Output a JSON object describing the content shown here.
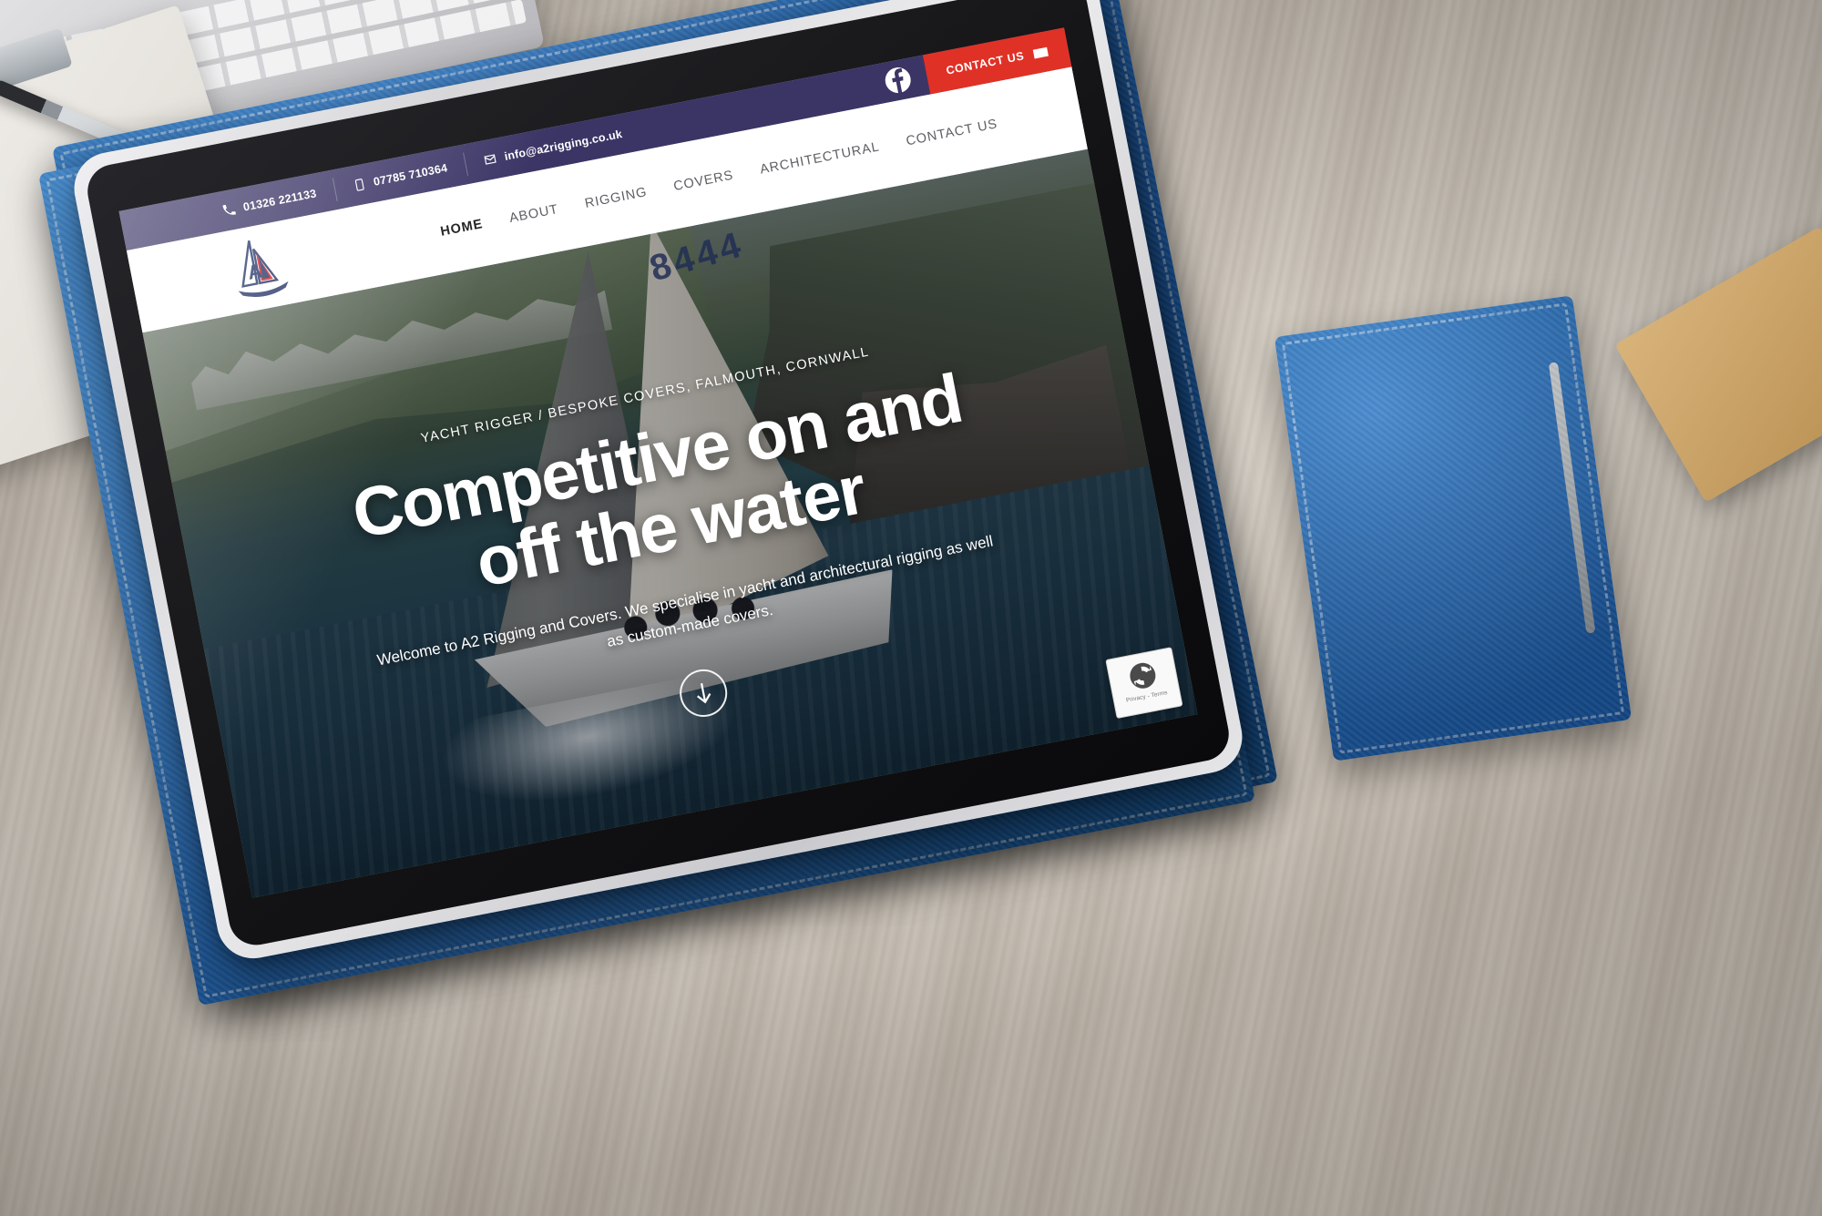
{
  "topbar": {
    "background_color": "#3b3566",
    "contacts": [
      {
        "icon": "phone-icon",
        "text": "01326 221133"
      },
      {
        "icon": "mobile-icon",
        "text": "07785 710364"
      },
      {
        "icon": "envelope-icon",
        "text": "info@a2rigging.co.uk"
      }
    ],
    "facebook_icon": "facebook-icon",
    "contact_button": {
      "label": "CONTACT US",
      "icon": "mail-send-icon",
      "color": "#e03127"
    }
  },
  "navbar": {
    "logo_alt": "A2 Rigging and Covers logo",
    "links": [
      {
        "label": "HOME",
        "active": true
      },
      {
        "label": "ABOUT",
        "active": false
      },
      {
        "label": "RIGGING",
        "active": false
      },
      {
        "label": "COVERS",
        "active": false
      },
      {
        "label": "ARCHITECTURAL",
        "active": false
      },
      {
        "label": "CONTACT US",
        "active": false
      }
    ]
  },
  "hero": {
    "eyebrow": "YACHT RIGGER / BESPOKE COVERS, FALMOUTH, CORNWALL",
    "title_line1": "Competitive on and",
    "title_line2": "off the water",
    "subtitle": "Welcome to A2 Rigging and Covers. We specialise in yacht and architectural rigging as well as custom-made covers.",
    "scroll_icon": "arrow-down-icon",
    "sail_number": "8444"
  },
  "recaptcha": {
    "icon": "recaptcha-icon",
    "text": "Privacy - Terms"
  }
}
